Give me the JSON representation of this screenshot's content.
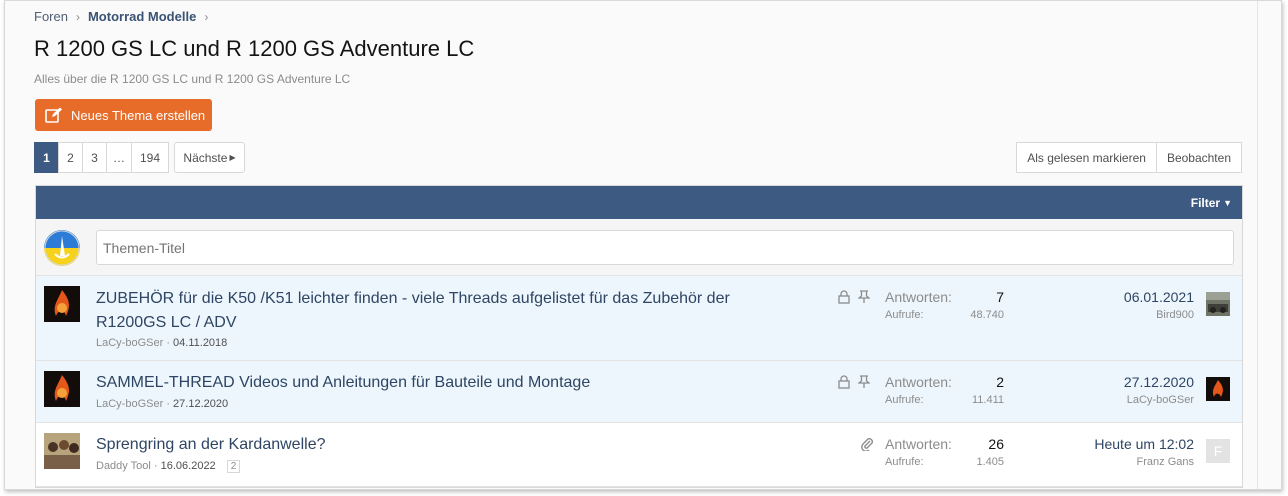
{
  "breadcrumb": {
    "root": "Foren",
    "current": "Motorrad Modelle"
  },
  "forum": {
    "title": "R 1200 GS LC und R 1200 GS Adventure LC",
    "description": "Alles über die R 1200 GS LC und R 1200 GS Adventure LC",
    "new_thread_label": "Neues Thema erstellen"
  },
  "pagination": {
    "pages": [
      "1",
      "2",
      "3",
      "…",
      "194"
    ],
    "current": "1",
    "next_label": "Nächste"
  },
  "actions": {
    "mark_read": "Als gelesen markieren",
    "watch": "Beobachten"
  },
  "list": {
    "filter_label": "Filter",
    "quick_thread_placeholder": "Themen-Titel",
    "threads": [
      {
        "title": "ZUBEHÖR für die K50 /K51 leichter finden - viele Threads aufgelistet für das Zubehör der R1200GS LC / ADV",
        "author": "LaCy-boGSer",
        "date": "04.11.2018",
        "replies_label": "Antworten:",
        "replies": "7",
        "views_label": "Aufrufe:",
        "views": "48.740",
        "last_date": "06.01.2021",
        "last_user": "Bird900"
      },
      {
        "title": "SAMMEL-THREAD Videos und Anleitungen für Bauteile und Montage",
        "author": "LaCy-boGSer",
        "date": "27.12.2020",
        "replies_label": "Antworten:",
        "replies": "2",
        "views_label": "Aufrufe:",
        "views": "11.411",
        "last_date": "27.12.2020",
        "last_user": "LaCy-boGSer"
      },
      {
        "title": "Sprengring an der Kardanwelle?",
        "author": "Daddy Tool",
        "date": "16.06.2022",
        "page_badge": "2",
        "replies_label": "Antworten:",
        "replies": "26",
        "views_label": "Aufrufe:",
        "views": "1.405",
        "last_date": "Heute um 12:02",
        "last_user": "Franz Gans",
        "last_avatar_letter": "F"
      }
    ]
  },
  "colors": {
    "accent": "#3d5b82",
    "button": "#e76c29",
    "sticky_bg": "#edf6fd"
  }
}
